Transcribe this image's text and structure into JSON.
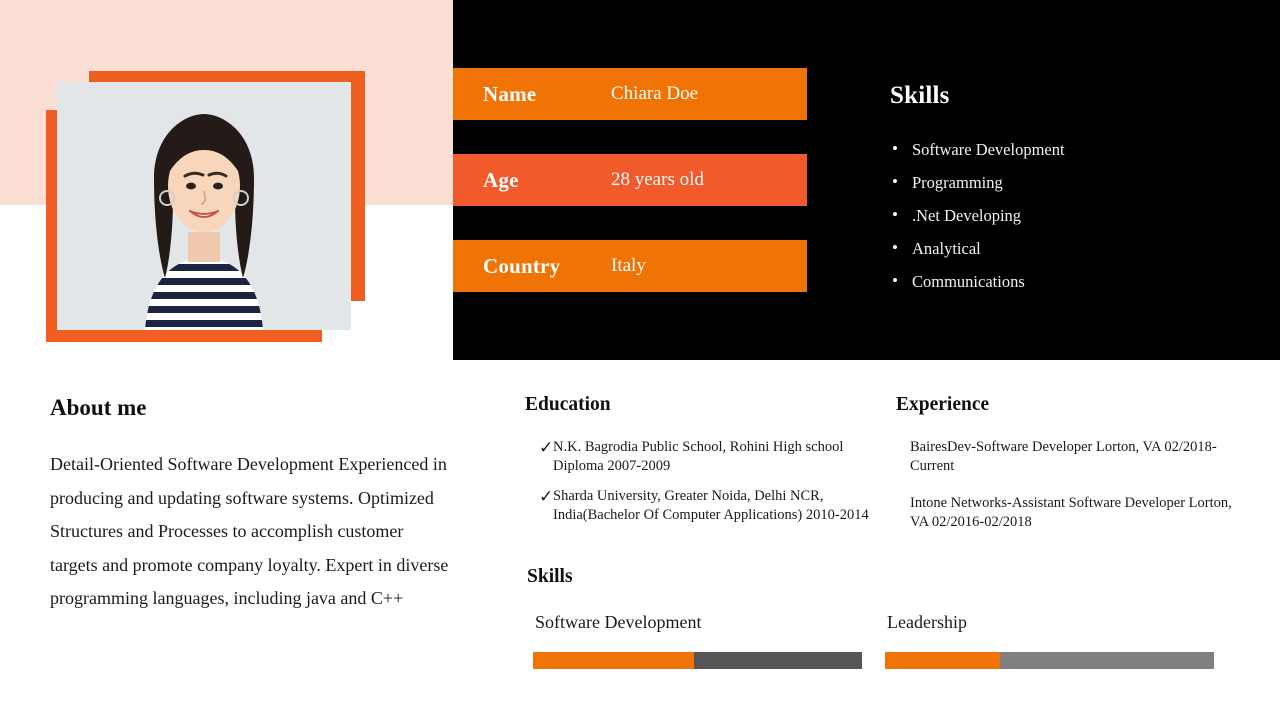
{
  "colors": {
    "peach_background": "#fbdfd4",
    "frame_orange": "#ef5f22",
    "bar_orange": "#f07305",
    "bar_coral": "#f15a2b",
    "panel_black": "#000000",
    "progress_fill": "#f07305",
    "progress_track_dark": "#565656",
    "progress_track_light": "#808080"
  },
  "photo": {
    "alt_name": "profile-photo",
    "background": "#e3e6e9"
  },
  "info": {
    "rows": [
      {
        "label": "Name",
        "value": "Chiara Doe"
      },
      {
        "label": "Age",
        "value": "28  years old"
      },
      {
        "label": "Country",
        "value": "Italy"
      }
    ]
  },
  "skills_panel": {
    "title": "Skills",
    "bullet": "•",
    "items": [
      "Software Development",
      "Programming",
      ".Net Developing",
      "Analytical",
      "Communications"
    ]
  },
  "about": {
    "title": "About me",
    "body": "Detail-Oriented Software Development Experienced in producing and updating software systems. Optimized Structures and Processes to accomplish customer targets and promote company loyalty. Expert in diverse programming languages, including java and C++"
  },
  "education": {
    "title": "Education",
    "check": "✓",
    "items": [
      "N.K. Bagrodia Public School, Rohini High school Diploma 2007-2009",
      "Sharda University, Greater Noida, Delhi NCR, India(Bachelor Of Computer Applications) 2010-2014"
    ]
  },
  "experience": {
    "title": "Experience",
    "items": [
      "BairesDev-Software Developer Lorton, VA 02/2018-Current",
      "Intone Networks-Assistant Software Developer Lorton, VA 02/2016-02/2018"
    ]
  },
  "skills_bars": {
    "title": "Skills",
    "items": [
      {
        "label": "Software Development",
        "percent": 49,
        "track": "#565656"
      },
      {
        "label": "Leadership",
        "percent": 35,
        "track": "#808080"
      }
    ]
  }
}
